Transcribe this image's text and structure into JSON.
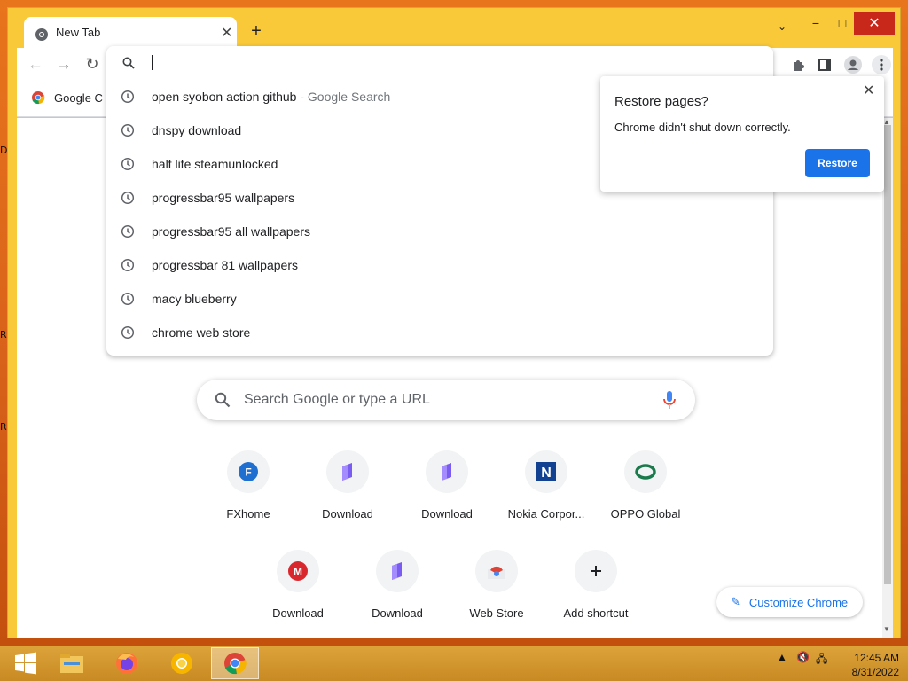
{
  "window": {
    "tab_title": "New Tab",
    "controls": {
      "minimize": "−",
      "maximize": "□",
      "close": "✕"
    }
  },
  "toolbar": {
    "omnibox_value": ""
  },
  "bookmarks": {
    "items": [
      {
        "label": "Google C",
        "icon": "chrome-icon"
      }
    ]
  },
  "omnibox": {
    "suggestions": [
      {
        "text": "open syobon action github",
        "suffix": " - Google Search",
        "icon": "history-icon"
      },
      {
        "text": "dnspy download",
        "icon": "history-icon"
      },
      {
        "text": "half life steamunlocked",
        "icon": "history-icon"
      },
      {
        "text": "progressbar95 wallpapers",
        "icon": "history-icon"
      },
      {
        "text": "progressbar95 all wallpapers",
        "icon": "history-icon"
      },
      {
        "text": "progressbar 81 wallpapers",
        "icon": "history-icon"
      },
      {
        "text": "macy blueberry",
        "icon": "history-icon"
      },
      {
        "text": "chrome web store",
        "icon": "history-icon"
      }
    ]
  },
  "restore_popup": {
    "title": "Restore pages?",
    "message": "Chrome didn't shut down correctly.",
    "button": "Restore"
  },
  "ntp": {
    "search_placeholder": "Search Google or type a URL",
    "shortcuts": [
      {
        "label": "FXhome",
        "icon": "fxhome-icon"
      },
      {
        "label": "Download",
        "icon": "download-icon"
      },
      {
        "label": "Download",
        "icon": "download-icon"
      },
      {
        "label": "Nokia Corpor...",
        "icon": "nokia-icon"
      },
      {
        "label": "OPPO Global",
        "icon": "oppo-icon"
      },
      {
        "label": "Download",
        "icon": "mega-icon"
      },
      {
        "label": "Download",
        "icon": "download-icon"
      },
      {
        "label": "Web Store",
        "icon": "webstore-icon"
      },
      {
        "label": "Add shortcut",
        "icon": "plus-icon"
      }
    ],
    "customize_label": "Customize Chrome"
  },
  "desktop": {
    "letters": [
      "D",
      "R",
      "R"
    ]
  },
  "taskbar": {
    "apps": [
      "start-icon",
      "file-explorer-icon",
      "firefox-icon",
      "chrome-canary-icon",
      "chrome-icon"
    ],
    "clock_time": "12:45 AM",
    "clock_date": "8/31/2022"
  },
  "colors": {
    "accent": "#1a73e8",
    "frame": "#f9c93a",
    "close_red": "#c7281a"
  }
}
